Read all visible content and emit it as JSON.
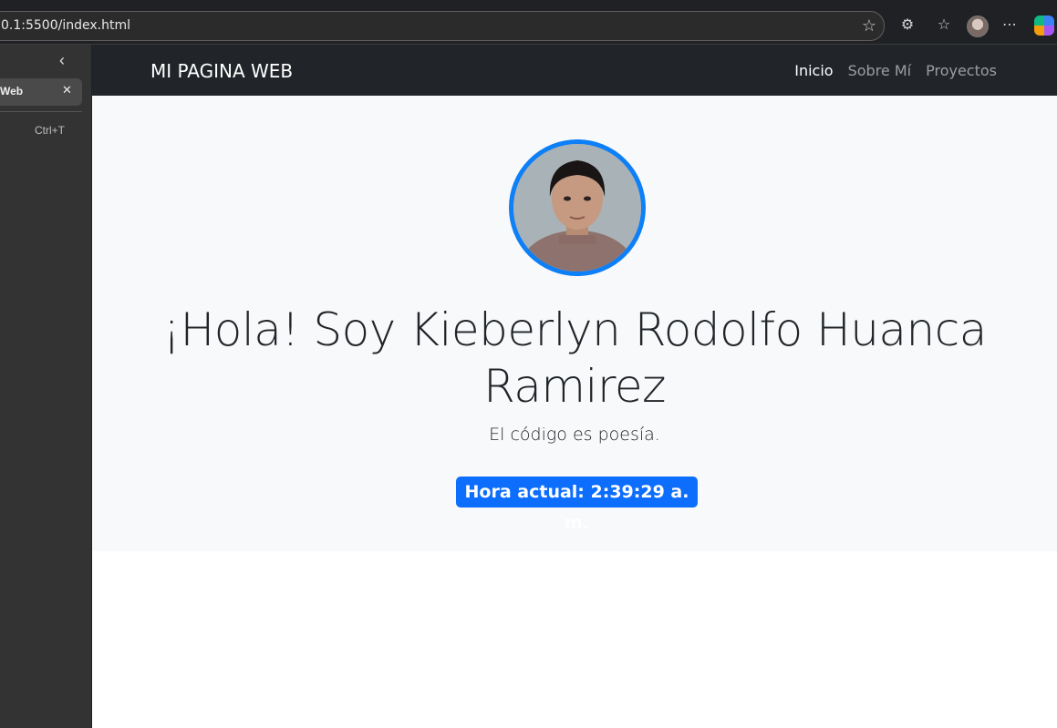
{
  "browser": {
    "address": "0.1:5500/index.html",
    "icons": [
      "star-icon",
      "extensions-icon",
      "favorites-icon",
      "profile-avatar",
      "more-icon",
      "copilot-icon"
    ]
  },
  "sidebar": {
    "tab_label": "Web",
    "tab_close": "✕",
    "collapse": "‹",
    "newtab_shortcut": "Ctrl+T"
  },
  "navbar": {
    "brand": "MI PAGINA WEB",
    "links": [
      "Inicio",
      "Sobre Mí",
      "Proyectos"
    ],
    "active": "Inicio"
  },
  "hero": {
    "title": "¡Hola! Soy Kieberlyn Rodolfo Huanca Ramirez",
    "subtitle": "El código es poesía.",
    "clock_label": "Hora actual: 2:39:29 a. m."
  },
  "colors": {
    "navbar_bg": "#212529",
    "hero_bg": "#f8f9fa",
    "accent": "#0d6efd",
    "profile_border": "#0d7ff7"
  }
}
